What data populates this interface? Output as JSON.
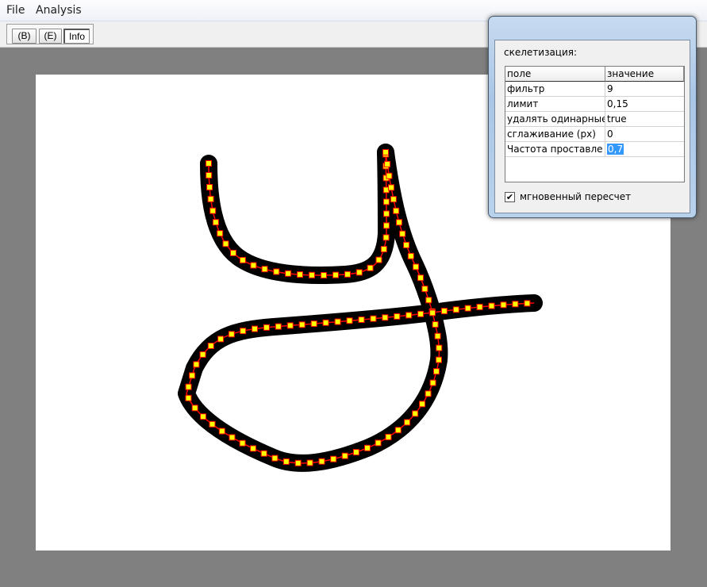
{
  "menu": {
    "items": [
      "File",
      "Analysis"
    ]
  },
  "toolbar": {
    "buttons": [
      "(B)",
      "(E)",
      "Info"
    ],
    "active": "Info"
  },
  "dialog": {
    "caption": "скелетизация:",
    "table": {
      "headers": [
        "поле",
        "значение"
      ],
      "rows": [
        [
          "фильтр",
          "9"
        ],
        [
          "лимит",
          "0,15"
        ],
        [
          "удалять одинарные",
          "true"
        ],
        [
          "сглаживание (px)",
          "0"
        ],
        [
          "Частота проставле",
          "0,7"
        ]
      ]
    },
    "checkbox": {
      "label": "мгновенный пересчет",
      "checked": true,
      "mark": "✔"
    }
  },
  "canvas": {
    "stroke_color": "#000000",
    "skeleton_color": "#ff0000",
    "node_color": "#ffff00",
    "background_color": "#ffffff"
  }
}
